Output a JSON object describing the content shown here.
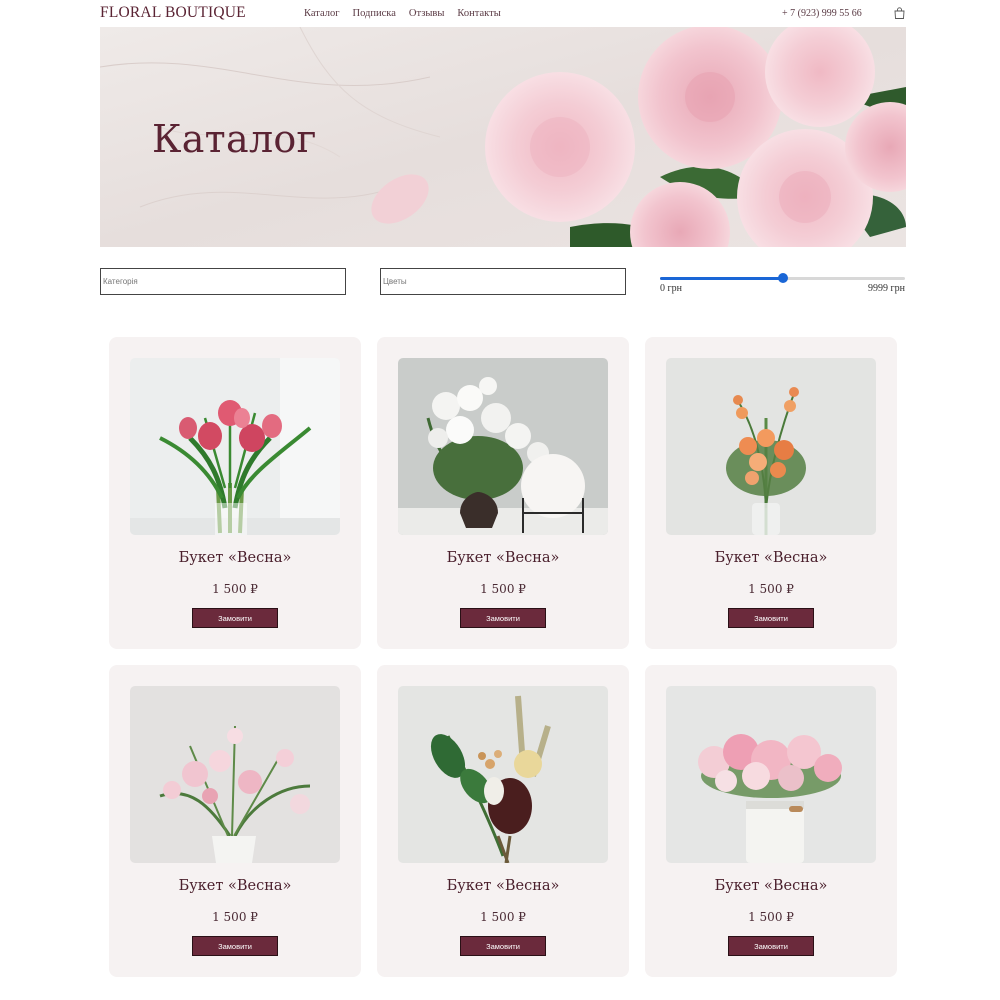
{
  "header": {
    "logo": "FLORAL BOUTIQUE",
    "nav": [
      "Каталог",
      "Подписка",
      "Отзывы",
      "Контакты"
    ],
    "phone": "+ 7 (923) 999 55 66",
    "cart_icon": "bag-icon"
  },
  "hero": {
    "title": "Каталог"
  },
  "filters": {
    "category_placeholder": "Категорія",
    "flowers_placeholder": "Цветы",
    "price_min_label": "0 грн",
    "price_max_label": "9999 грн",
    "price_value_fraction": 0.5
  },
  "colors": {
    "accent": "#6b2a3c",
    "slider": "#1a66d6",
    "card_bg": "#f6f2f2"
  },
  "products": [
    {
      "name": "Букет «Весна»",
      "price": "1 500 ₽",
      "button": "Замовити"
    },
    {
      "name": "Букет «Весна»",
      "price": "1 500 ₽",
      "button": "Замовити"
    },
    {
      "name": "Букет «Весна»",
      "price": "1 500 ₽",
      "button": "Замовити"
    },
    {
      "name": "Букет «Весна»",
      "price": "1 500 ₽",
      "button": "Замовити"
    },
    {
      "name": "Букет «Весна»",
      "price": "1 500 ₽",
      "button": "Замовити"
    },
    {
      "name": "Букет «Весна»",
      "price": "1 500 ₽",
      "button": "Замовити"
    }
  ]
}
